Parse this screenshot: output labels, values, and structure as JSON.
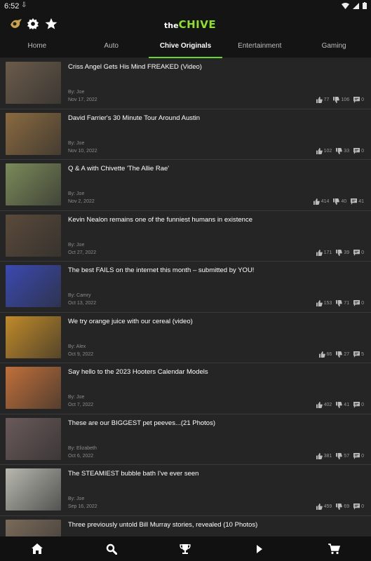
{
  "status": {
    "time": "6:52"
  },
  "tabs": [
    {
      "label": "Home"
    },
    {
      "label": "Auto"
    },
    {
      "label": "Chive Originals"
    },
    {
      "label": "Entertainment"
    },
    {
      "label": "Gaming"
    }
  ],
  "articles": [
    {
      "title": "Criss Angel Gets His Mind FREAKED (Video)",
      "by": "By: Joe",
      "date": "Nov 17, 2022",
      "likes": "77",
      "dislikes": "106",
      "comments": "0",
      "thumb": "#6b5b4a"
    },
    {
      "title": "David Farrier's 30 Minute Tour Around Austin",
      "by": "By: Joe",
      "date": "Nov 10, 2022",
      "likes": "102",
      "dislikes": "33",
      "comments": "0",
      "thumb": "#8a6a40"
    },
    {
      "title": "Q & A with Chivette 'The Allie Rae'",
      "by": "By: Joe",
      "date": "Nov 2, 2022",
      "likes": "414",
      "dislikes": "40",
      "comments": "41",
      "thumb": "#7b8a5a"
    },
    {
      "title": "Kevin Nealon remains one of the funniest humans in existence",
      "by": "By: Joe",
      "date": "Oct 27, 2022",
      "likes": "171",
      "dislikes": "39",
      "comments": "0",
      "thumb": "#5a4a3a"
    },
    {
      "title": "The best FAILS on the internet this month – submitted by YOU!",
      "by": "By: Camry",
      "date": "Oct 13, 2022",
      "likes": "153",
      "dislikes": "71",
      "comments": "0",
      "thumb": "#3a4ab0"
    },
    {
      "title": "We try orange juice with our cereal (video)",
      "by": "By: Alex",
      "date": "Oct 9, 2022",
      "likes": "66",
      "dislikes": "27",
      "comments": "5",
      "thumb": "#c08a2a"
    },
    {
      "title": "Say hello to the 2023 Hooters Calendar Models",
      "by": "By: Joe",
      "date": "Oct 7, 2022",
      "likes": "402",
      "dislikes": "41",
      "comments": "0",
      "thumb": "#c0703a"
    },
    {
      "title": "These are our BIGGEST pet peeves...(21 Photos)",
      "by": "By: Elizabeth",
      "date": "Oct 6, 2022",
      "likes": "381",
      "dislikes": "57",
      "comments": "0",
      "thumb": "#6a5a5a"
    },
    {
      "title": "The STEAMIEST bubble bath I've ever seen",
      "by": "By: Joe",
      "date": "Sep 16, 2022",
      "likes": "459",
      "dislikes": "69",
      "comments": "0",
      "thumb": "#b8b8b0"
    },
    {
      "title": "Three previously untold Bill Murray stories, revealed (10 Photos)",
      "by": "",
      "date": "",
      "likes": "",
      "dislikes": "",
      "comments": "",
      "thumb": "#7a6a5a"
    }
  ],
  "logo": {
    "prefix": "the",
    "name": "CHIVE"
  },
  "colors": {
    "accent": "#66d82c",
    "background": "#141414",
    "row": "#252525"
  }
}
